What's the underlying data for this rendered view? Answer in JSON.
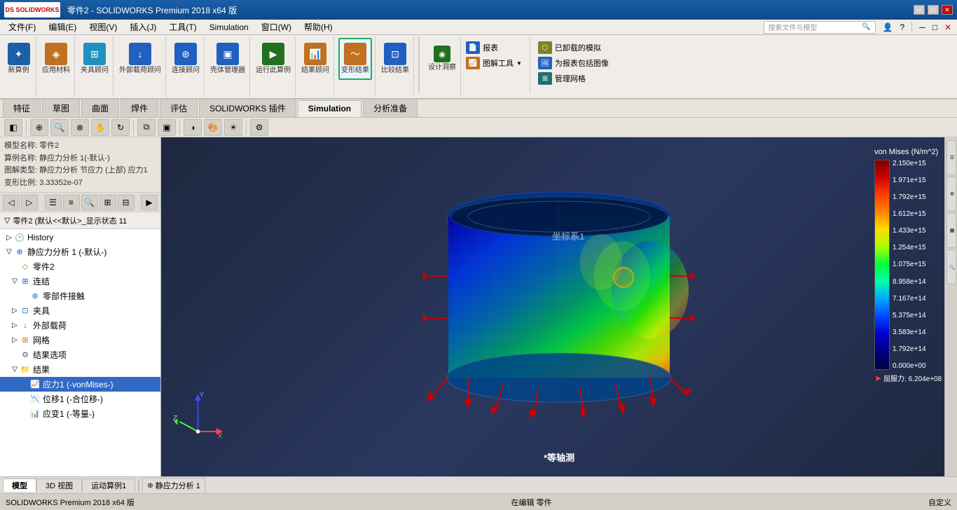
{
  "app": {
    "title": "零件2 - SOLIDWORKS Premium 2018 x64 版",
    "logo": "DS SOLIDWORKS"
  },
  "menubar": {
    "items": [
      "文件(F)",
      "编辑(E)",
      "视图(V)",
      "插入(J)",
      "工具(T)",
      "Simulation",
      "窗口(W)",
      "帮助(H)"
    ]
  },
  "toolbar": {
    "groups": [
      {
        "name": "新算例",
        "icon": "✦",
        "color": "#2060c0"
      },
      {
        "name": "应用材料",
        "icon": "◈",
        "color": "#c07020"
      },
      {
        "name": "夹具顾问",
        "icon": "⊞",
        "color": "#2090c0"
      },
      {
        "name": "外部载荷顾问",
        "icon": "↓",
        "color": "#2060c0"
      },
      {
        "name": "连接顾问",
        "icon": "⊛",
        "color": "#2060c0"
      },
      {
        "name": "壳体管理器",
        "icon": "▣",
        "color": "#2060c0"
      },
      {
        "name": "运行此算例",
        "icon": "▶",
        "color": "#207020"
      },
      {
        "name": "结果顾问",
        "icon": "📊",
        "color": "#c07020"
      },
      {
        "name": "变形结果",
        "icon": "〜",
        "color": "#c07020",
        "selected": true
      },
      {
        "name": "比较结果",
        "icon": "⊡",
        "color": "#2060c0"
      }
    ],
    "right_groups": [
      {
        "name": "设计洞察",
        "icon": "◉"
      },
      {
        "name": "报表",
        "icon": "📄"
      },
      {
        "name": "图解工具",
        "icon": "📈"
      },
      {
        "name": "已卸载的模拟",
        "icon": "⬡"
      },
      {
        "name": "为报表包括图像",
        "icon": "🖼"
      },
      {
        "name": "管理网格",
        "icon": "⊞"
      }
    ]
  },
  "tabs": [
    "特征",
    "草图",
    "曲面",
    "焊件",
    "评估",
    "SOLIDWORKS 插件",
    "Simulation",
    "分析准备"
  ],
  "activeTab": "Simulation",
  "info": {
    "model_name": "模型名称: 零件2",
    "study_name": "算例名称: 静应力分析 1(-默认-)",
    "plot_type": "图解类型: 静应力分析 节应力 (上部) 应力1",
    "deform_scale": "变形比例: 3.33352e-07"
  },
  "second_toolbar": {
    "buttons": [
      "⊕",
      "⊗",
      "↰",
      "⊞",
      "⊙",
      "◎",
      "⊕",
      "⊠",
      "▶",
      "◀",
      "⊟",
      "⊞"
    ]
  },
  "tree": {
    "title": "零件2 (默认<<默认>_显示状态 11",
    "history": "History",
    "nodes": [
      {
        "label": "静应力分析 1 (-默认-)",
        "icon": "⊕",
        "iconColor": "#2060c0",
        "indent": 0,
        "expanded": true,
        "id": "study"
      },
      {
        "label": "零件2",
        "icon": "◇",
        "iconColor": "#c07020",
        "indent": 1,
        "id": "part"
      },
      {
        "label": "连结",
        "icon": "⊞",
        "iconColor": "#2060c0",
        "indent": 1,
        "expanded": true,
        "id": "connections"
      },
      {
        "label": "零部件接触",
        "icon": "⊛",
        "iconColor": "#2060c0",
        "indent": 2,
        "id": "contact"
      },
      {
        "label": "夹具",
        "icon": "⊡",
        "iconColor": "#2060c0",
        "indent": 1,
        "id": "fixtures"
      },
      {
        "label": "外部载荷",
        "icon": "↓",
        "iconColor": "#2060c0",
        "indent": 1,
        "id": "loads"
      },
      {
        "label": "网格",
        "icon": "⊞",
        "iconColor": "#c07020",
        "indent": 1,
        "id": "mesh"
      },
      {
        "label": "结果选项",
        "icon": "⚙",
        "iconColor": "#606060",
        "indent": 1,
        "id": "resultopts"
      },
      {
        "label": "结果",
        "icon": "📁",
        "iconColor": "#606060",
        "indent": 1,
        "expanded": true,
        "id": "results"
      },
      {
        "label": "应力1 (-vonMises-)",
        "icon": "📈",
        "iconColor": "#2060c0",
        "indent": 2,
        "selected": true,
        "id": "stress"
      },
      {
        "label": "位移1 (-合位移-)",
        "icon": "📉",
        "iconColor": "#207070",
        "indent": 2,
        "id": "displacement"
      },
      {
        "label": "应变1 (-等量-)",
        "icon": "📊",
        "iconColor": "#207020",
        "indent": 2,
        "id": "strain"
      }
    ]
  },
  "colorbar": {
    "title": "von Mises (N/m^2)",
    "values": [
      "2.150e+15",
      "1.971e+15",
      "1.792e+15",
      "1.612e+15",
      "1.433e+15",
      "1.254e+15",
      "1.075e+15",
      "8.958e+14",
      "7.167e+14",
      "5.375e+14",
      "3.583e+14",
      "1.792e+14",
      "0.000e+00"
    ],
    "yield": "屈服力: 6.204e+08"
  },
  "viewport": {
    "view_label": "*等轴测",
    "coord_label": "坐标系1"
  },
  "statusbar": {
    "tabs": [
      "模型",
      "3D 视图",
      "运动算例1"
    ],
    "active_tab": "模型",
    "sim_tab": "静应力分析 1",
    "status": "在编辑 零件",
    "customize": "自定义"
  },
  "bottom_status": {
    "left": "SOLIDWORKS Premium 2018 x64 版",
    "middle": "在编辑 零件",
    "right": "自定义"
  }
}
